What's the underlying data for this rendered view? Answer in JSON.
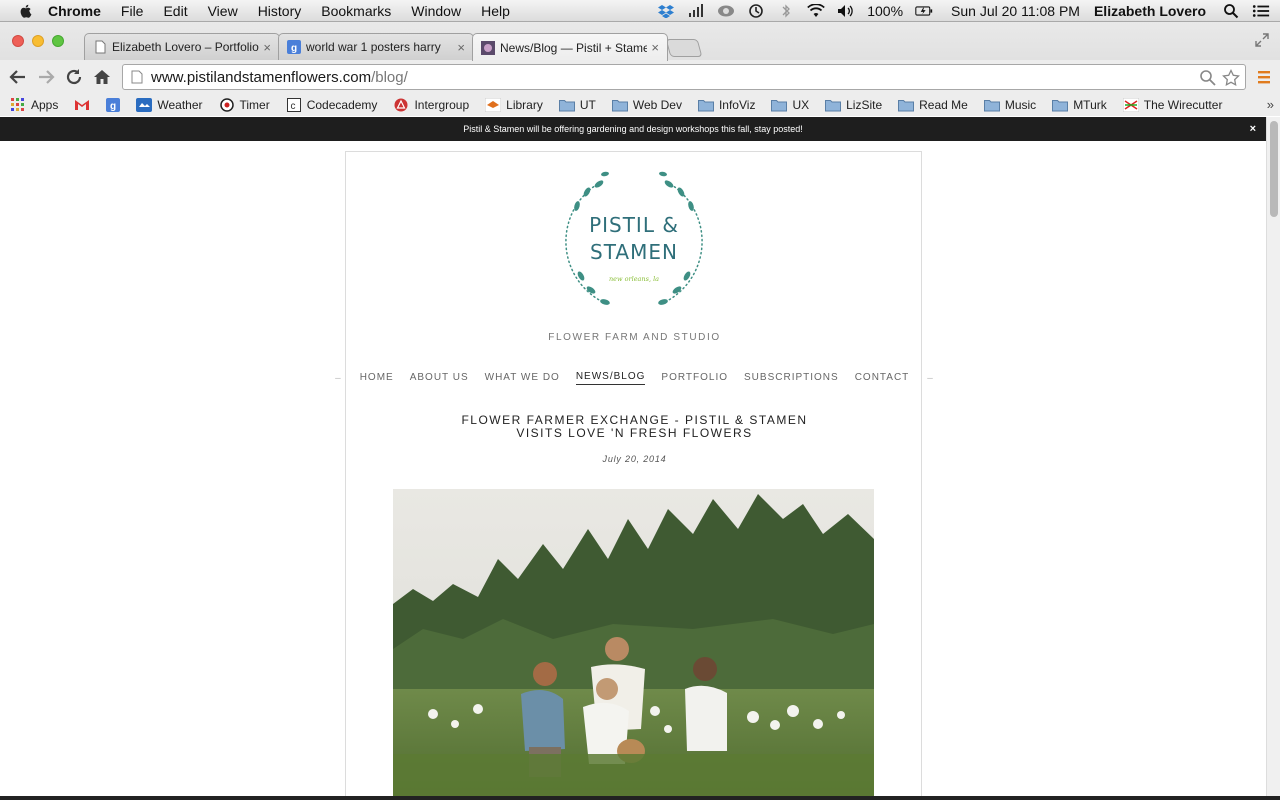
{
  "menubar": {
    "app": "Chrome",
    "menus": [
      "File",
      "Edit",
      "View",
      "History",
      "Bookmarks",
      "Window",
      "Help"
    ],
    "battery": "100%",
    "clock": "Sun Jul 20  11:08 PM",
    "user": "Elizabeth Lovero"
  },
  "tabs": [
    {
      "title": "Elizabeth Lovero – Portfolio",
      "close": "×"
    },
    {
      "title": "world war 1 posters harry",
      "close": "×"
    },
    {
      "title": "News/Blog — Pistil + Stamen",
      "close": "×"
    }
  ],
  "address": {
    "domain": "www.pistilandstamenflowers.com",
    "path": "/blog/"
  },
  "bookmarks": [
    "Apps",
    "Weather",
    "Timer",
    "Codecademy",
    "Intergroup",
    "Library",
    "UT",
    "Web Dev",
    "InfoViz",
    "UX",
    "LizSite",
    "Read Me",
    "Music",
    "MTurk",
    "The Wirecutter"
  ],
  "bookmarks_more": "»",
  "announcement": {
    "text": "Pistil & Stamen will be offering gardening and design workshops this fall, stay posted!",
    "close": "×"
  },
  "site": {
    "logo_line1": "PISTIL &",
    "logo_line2": "STAMEN",
    "logo_location": "new orleans, la",
    "tagline": "FLOWER FARM AND STUDIO",
    "nav": [
      "HOME",
      "ABOUT US",
      "WHAT WE DO",
      "NEWS/BLOG",
      "PORTFOLIO",
      "SUBSCRIPTIONS",
      "CONTACT"
    ],
    "nav_dash": "–",
    "active_nav": "NEWS/BLOG",
    "post_title_line1": "FLOWER FARMER EXCHANGE - PISTIL & STAMEN",
    "post_title_line2": "VISITS LOVE 'N FRESH FLOWERS",
    "post_date": "July 20, 2014"
  },
  "colors": {
    "brand_teal": "#3e8f84",
    "brand_green": "#8bbf3a",
    "announcement_bg": "#1e1e1e"
  }
}
